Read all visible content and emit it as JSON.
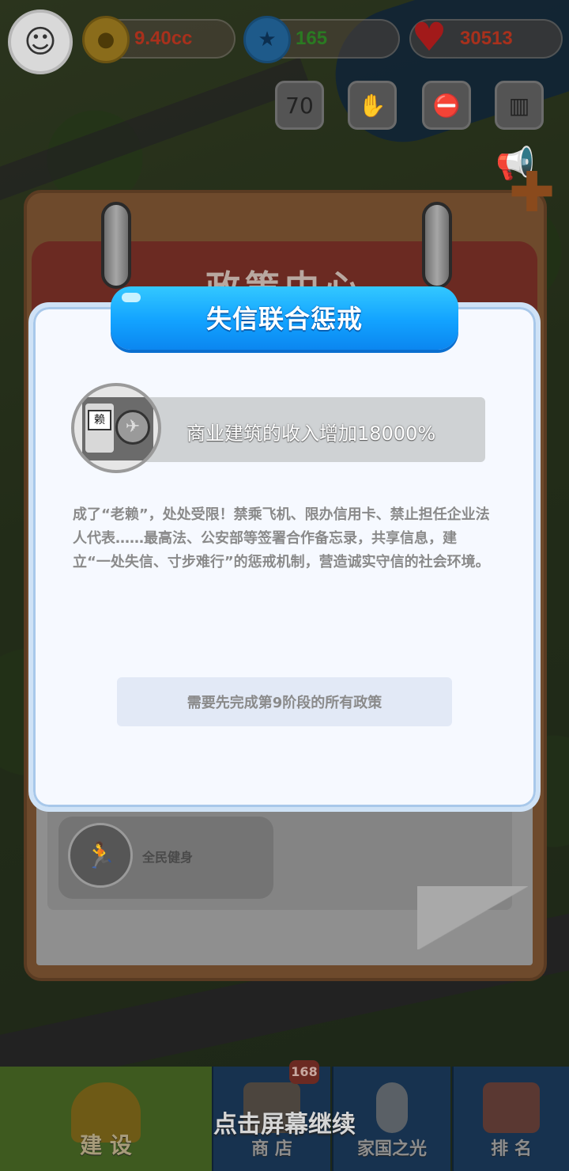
{
  "hud": {
    "coins": "9.40cc",
    "stars": "165",
    "hearts": "30513",
    "quick_icons": [
      "anniversary-70-icon",
      "handshake-icon",
      "anti-fraud-icon",
      "city-skyline-icon"
    ]
  },
  "notebook": {
    "title": "政策中心",
    "policy_card_label": "全民健身"
  },
  "modal": {
    "title": "失信联合惩戒",
    "effect": "商业建筑的收入增加18000%",
    "icon_stamp": "赖",
    "description": "成了“老赖”，处处受限！禁乘飞机、限办信用卡、禁止担任企业法人代表……最高法、公安部等签署合作备忘录，共享信息，建立“一处失信、寸步难行”的惩戒机制，营造诚实守信的社会环境。",
    "requirement": "需要先完成第9阶段的所有政策"
  },
  "bottom_nav": {
    "build": "建 设",
    "shop": "商 店",
    "shop_badge": "168",
    "home": "家国之光",
    "rank": "排 名"
  },
  "tap_to_continue": "点击屏幕继续",
  "colors": {
    "banner_blue": "#12a2ff",
    "modal_bg": "#f6f9ff",
    "coin_text": "#a8301c",
    "star_text": "#2a7a22"
  }
}
